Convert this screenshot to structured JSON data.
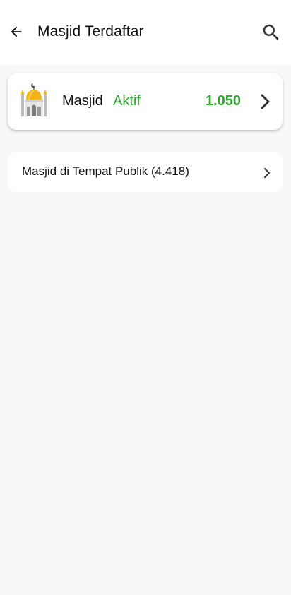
{
  "header": {
    "title": "Masjid Terdaftar",
    "back_icon": "arrow-left-icon",
    "search_icon": "search-icon"
  },
  "active_card": {
    "icon": "mosque-icon",
    "label": "Masjid",
    "status": "Aktif",
    "count": "1.050",
    "chevron_icon": "chevron-right-icon"
  },
  "public_card": {
    "label": "Masjid di Tempat Publik (4.418)",
    "chevron_icon": "chevron-right-icon"
  },
  "colors": {
    "accent_green": "#2ea82e",
    "background": "#f8f8f8",
    "surface": "#ffffff",
    "dome_gold": "#f2b519"
  }
}
